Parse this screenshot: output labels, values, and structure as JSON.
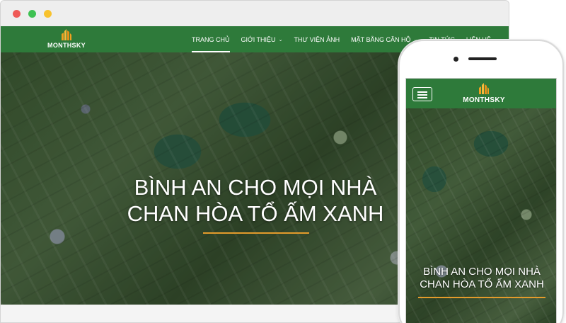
{
  "brand": {
    "name": "MONTHSKY",
    "nav_color": "#2e7a3a",
    "accent_color": "#e39b2b",
    "logo_icon": "building-logo-icon"
  },
  "desktop": {
    "menu": [
      {
        "label": "TRANG CHỦ",
        "active": true,
        "dropdown": false
      },
      {
        "label": "GIỚI THIỆU",
        "active": false,
        "dropdown": true
      },
      {
        "label": "THƯ VIỆN ẢNH",
        "active": false,
        "dropdown": false
      },
      {
        "label": "MẶT BẰNG CĂN HỘ",
        "active": false,
        "dropdown": true
      },
      {
        "label": "TIN TỨC",
        "active": false,
        "dropdown": false
      },
      {
        "label": "LIÊN HỆ",
        "active": false,
        "dropdown": false
      }
    ],
    "hero": {
      "line1": "BÌNH AN CHO MỌI NHÀ",
      "line2": "CHAN HÒA TỔ ẤM XANH"
    }
  },
  "mobile": {
    "menu_toggle_icon": "hamburger-icon",
    "hero": {
      "line1": "BÌNH AN CHO MỌI NHÀ",
      "line2": "CHAN HÒA TỔ ẤM XANH"
    }
  }
}
